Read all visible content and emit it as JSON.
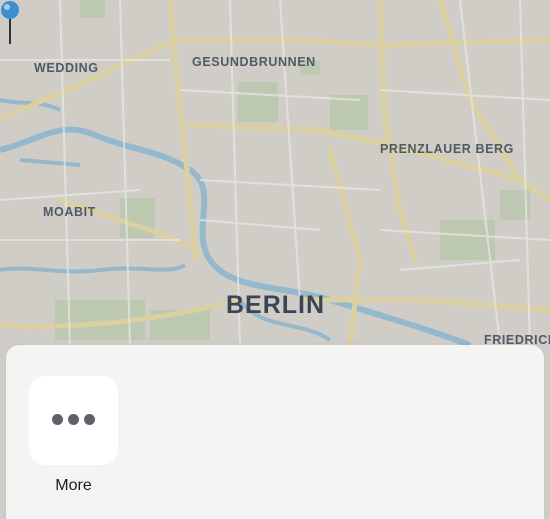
{
  "map": {
    "districts": {
      "wedding": "WEDDING",
      "gesundbrunnen": "GESUNDBRUNNEN",
      "prenzlauer_berg": "PRENZLAUER BERG",
      "moabit": "MOABIT",
      "friedrichshain": "FRIEDRICH"
    },
    "city": "BERLIN",
    "pin_color": "#3e8fd0"
  },
  "sheet": {
    "actions": [
      {
        "label": "More",
        "icon": "ellipsis-icon"
      }
    ]
  },
  "colors": {
    "map_land": "#e3e0d8",
    "map_road": "#f1e3a8",
    "map_water": "#9cc6de",
    "map_park": "#c5d7b5",
    "sheet_bg": "#f4f4f3",
    "label_text": "#4f5a66"
  }
}
